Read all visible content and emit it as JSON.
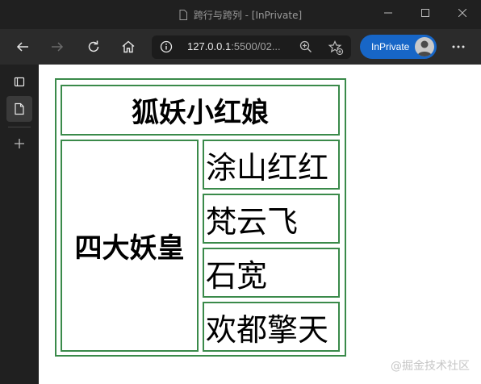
{
  "window": {
    "title": "跨行与跨列 - [InPrivate]",
    "controls": [
      "minimize",
      "maximize",
      "close"
    ]
  },
  "toolbar": {
    "url_host": "127.0.0.1",
    "url_rest": ":5500/02...",
    "inprivate_label": "InPrivate",
    "icons": [
      "back-icon",
      "forward-icon",
      "refresh-icon",
      "home-icon",
      "info-icon",
      "zoom-icon",
      "add-favorite-icon",
      "more-icon"
    ]
  },
  "sidebar": {
    "items": [
      "tab-actions-icon",
      "current-tab-icon",
      "new-tab-icon"
    ]
  },
  "table": {
    "header": "狐妖小红娘",
    "side_label": "四大妖皇",
    "items": [
      "涂山红红",
      "梵云飞",
      "石宽",
      "欢都擎天"
    ]
  },
  "watermark": "@掘金技术社区",
  "colors": {
    "border": "#3a8a4a",
    "inprivate": "#1766c7",
    "chrome": "#202020"
  }
}
